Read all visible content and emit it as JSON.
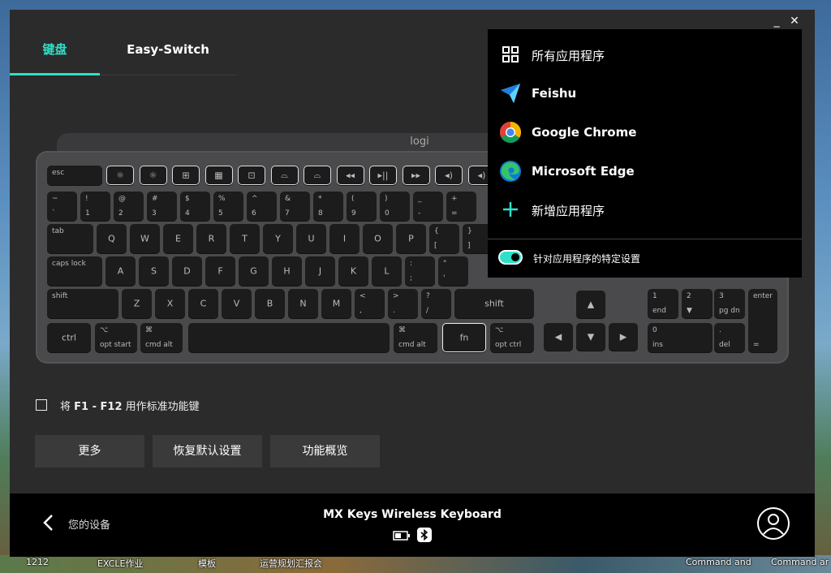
{
  "window": {
    "minimize": "_",
    "close": "✕"
  },
  "tabs": [
    {
      "label": "键盘",
      "active": true
    },
    {
      "label": "Easy-Switch",
      "active": false
    }
  ],
  "keyboard": {
    "logo": "logi",
    "fn_row": [
      "esc",
      "☼",
      "☼",
      "⊞",
      "▦",
      "⊡",
      "⌓",
      "⌓",
      "◂◂",
      "▸||",
      "▸▸",
      "◂)",
      "◂)"
    ],
    "num_row": [
      [
        "~",
        "`"
      ],
      [
        "!",
        "1"
      ],
      [
        "@",
        "2"
      ],
      [
        "#",
        "3"
      ],
      [
        "$",
        "4"
      ],
      [
        "%",
        "5"
      ],
      [
        "^",
        "6"
      ],
      [
        "&",
        "7"
      ],
      [
        "*",
        "8"
      ],
      [
        "(",
        "9"
      ],
      [
        ")",
        "0"
      ],
      [
        "_",
        "-"
      ],
      [
        "+",
        "="
      ]
    ],
    "tab_row": [
      "tab",
      "Q",
      "W",
      "E",
      "R",
      "T",
      "Y",
      "U",
      "I",
      "O",
      "P"
    ],
    "tab_row_brackets": [
      [
        "{",
        "["
      ],
      [
        "}",
        "]"
      ]
    ],
    "caps_row": [
      "caps lock",
      "A",
      "S",
      "D",
      "F",
      "G",
      "H",
      "J",
      "K",
      "L"
    ],
    "caps_row_punct": [
      [
        ":",
        ";"
      ],
      [
        "\"",
        "'"
      ]
    ],
    "shift_row": [
      "shift",
      "Z",
      "X",
      "C",
      "V",
      "B",
      "N",
      "M"
    ],
    "shift_row_punct": [
      [
        "<",
        ","
      ],
      [
        ">",
        "."
      ],
      [
        "?",
        "/"
      ]
    ],
    "shift_right": "shift",
    "bottom_row": {
      "ctrl": "ctrl",
      "opt_start": [
        "⌥",
        "opt",
        "start"
      ],
      "cmd_alt": [
        "⌘",
        "cmd",
        "alt"
      ],
      "cmd_alt_right": [
        "⌘",
        "cmd",
        "alt"
      ],
      "fn": "fn",
      "opt_ctrl": [
        "⌥",
        "opt",
        "ctrl"
      ]
    },
    "arrows": {
      "up": "▲",
      "left": "◀",
      "down": "▼",
      "right": "▶"
    },
    "numpad": {
      "one": [
        "1",
        "end"
      ],
      "two": [
        "2",
        "▼"
      ],
      "three": [
        "3",
        "pg dn"
      ],
      "zero": [
        "0",
        "ins"
      ],
      "dot": [
        ".",
        "del"
      ],
      "enter": "enter",
      "equals": "="
    }
  },
  "f12_option": {
    "label_prefix": "将 ",
    "label_bold": "F1 - F12",
    "label_suffix": " 用作标准功能键",
    "checked": false
  },
  "buttons": {
    "more": "更多",
    "reset": "恢复默认设置",
    "overview": "功能概览"
  },
  "footer": {
    "back_label": "您的设备",
    "device_name": "MX Keys Wireless Keyboard"
  },
  "app_menu": {
    "items": [
      {
        "label": "所有应用程序",
        "icon": "grid-icon"
      },
      {
        "label": "Feishu",
        "icon": "feishu-icon"
      },
      {
        "label": "Google Chrome",
        "icon": "chrome-icon"
      },
      {
        "label": "Microsoft Edge",
        "icon": "edge-icon"
      },
      {
        "label": "新增应用程序",
        "icon": "plus-icon"
      }
    ],
    "toggle_label": "针对应用程序的特定设置",
    "toggle_on": true
  },
  "desktop_labels": [
    "1212",
    "EXCLE作业",
    "模板",
    "运营规划汇报会",
    "Command and",
    "Command ar"
  ],
  "colors": {
    "accent": "#2ee0c8",
    "panel": "#2b2b2b",
    "menu": "#000000"
  }
}
